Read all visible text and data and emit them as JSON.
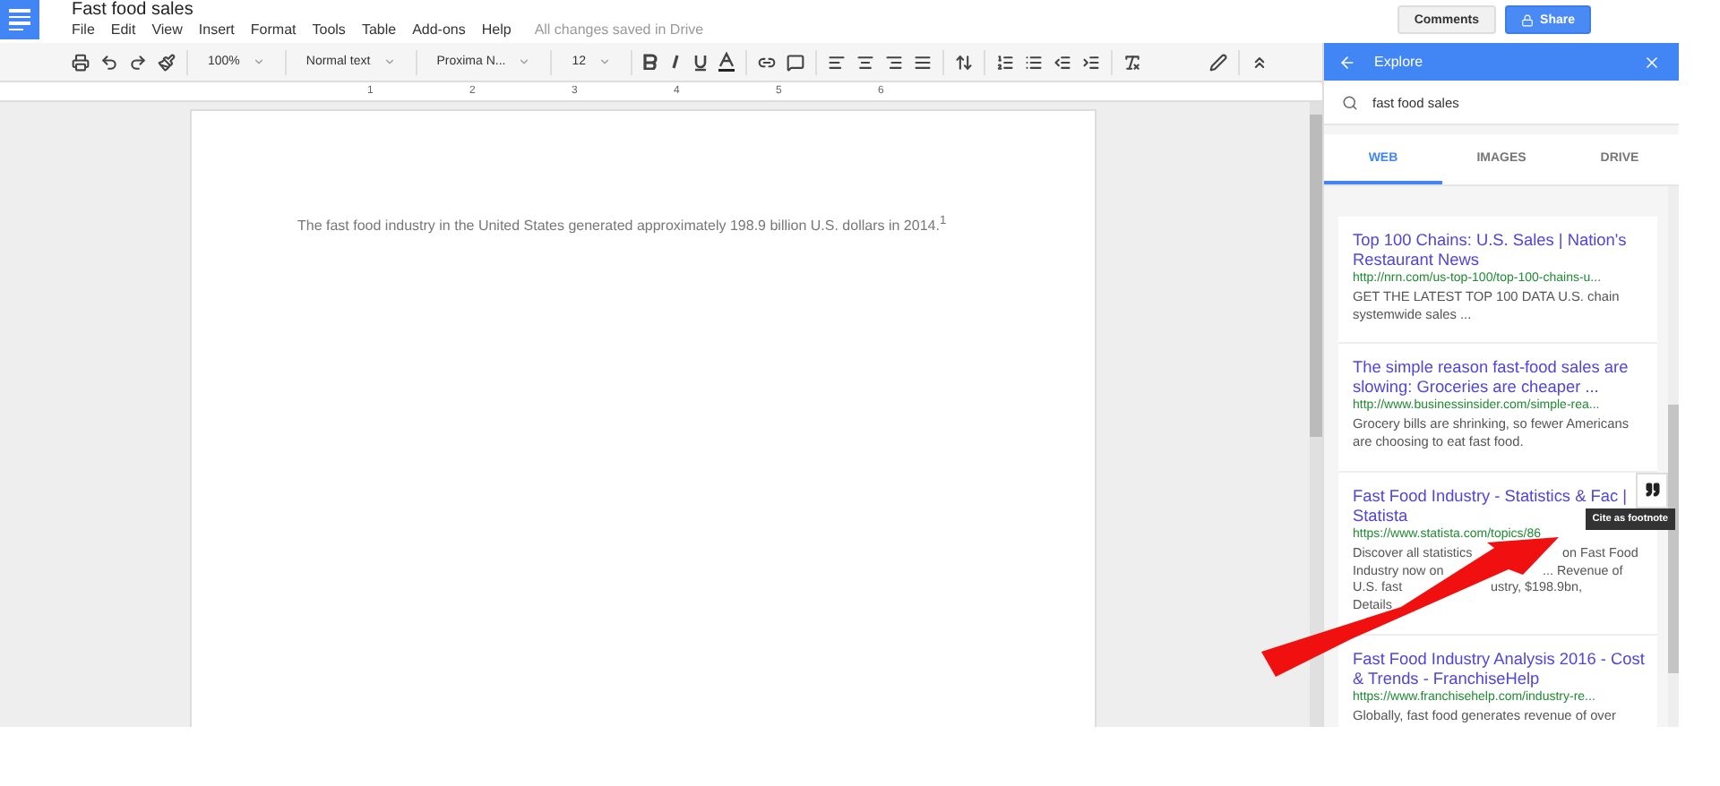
{
  "document": {
    "title": "Fast food sales",
    "menu": [
      "File",
      "Edit",
      "View",
      "Insert",
      "Format",
      "Tools",
      "Table",
      "Add-ons",
      "Help"
    ],
    "save_status": "All changes saved in Drive",
    "body": "The fast food industry in the United States generated approximately 198.9 billion U.S. dollars in 2014.$^{1}$"
  },
  "header_buttons": {
    "comments": "Comments",
    "share": "Share"
  },
  "toolbar": {
    "zoom": "100%",
    "style": "Normal text",
    "font": "Proxima N...",
    "size": "12"
  },
  "ruler": [
    "1",
    "2",
    "3",
    "4",
    "5",
    "6"
  ],
  "explore": {
    "title": "Explore",
    "search": "fast food sales",
    "tabs": [
      {
        "label": "WEB",
        "selected": true
      },
      {
        "label": "IMAGES",
        "selected": false
      },
      {
        "label": "DRIVE",
        "selected": false
      }
    ],
    "results": [
      {
        "title": "Top 100 Chains: U.S. Sales | Nation's Restaurant News",
        "url": "http://nrn.com/us-top-100/top-100-chains-u...",
        "snippet": "GET THE LATEST TOP 100 DATA U.S. chain systemwide sales ...",
        "cite": false
      },
      {
        "title": "The simple reason fast-food sales are slowing: Groceries are cheaper ...",
        "url": "http://www.businessinsider.com/simple-rea...",
        "snippet": "Grocery bills are shrinking, so fewer Americans are choosing to eat fast food.",
        "cite": false
      },
      {
        "title": "Fast Food Industry - Statistics & Fac | Statista",
        "url": "https://www.statista.com/topics/86",
        "snippet_lines": [
          [
            "Discover all statistics",
            "on Fast Food"
          ],
          [
            "Industry now on",
            "... Revenue of"
          ],
          [
            "U.S. fast",
            "ustry, $198.9bn,"
          ],
          [
            "Details"
          ]
        ],
        "cite": true
      },
      {
        "title": "Fast Food Industry Analysis 2016 - Cost & Trends - FranchiseHelp",
        "url": "https://www.franchisehelp.com/industry-re...",
        "snippet": "Globally, fast food generates revenue of over",
        "cite": false
      }
    ],
    "tooltip": "Cite as footnote"
  }
}
